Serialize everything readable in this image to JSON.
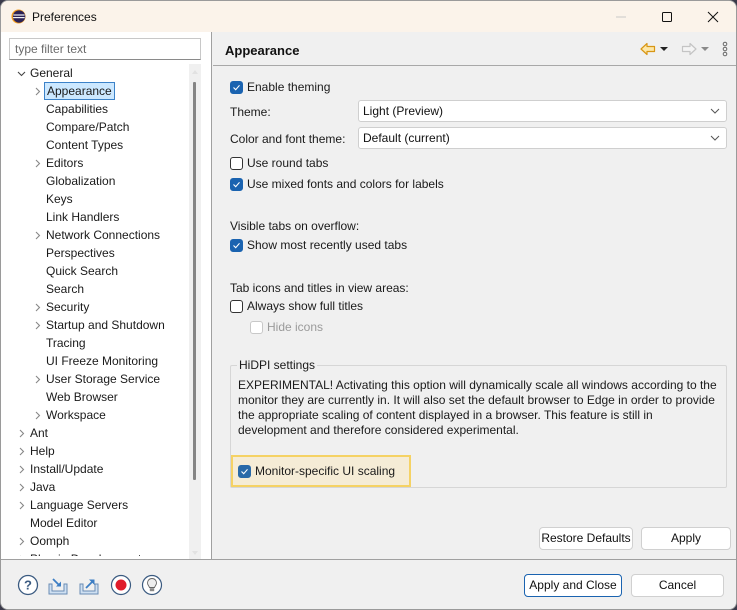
{
  "window": {
    "title": "Preferences",
    "icon": "eclipse-icon",
    "controls": [
      "minimize",
      "maximize",
      "close"
    ]
  },
  "left": {
    "filter_placeholder": "type filter text",
    "filter_value": "",
    "tree": [
      {
        "label": "General",
        "level": 0,
        "expander": "expanded"
      },
      {
        "label": "Appearance",
        "level": 1,
        "expander": "collapsed",
        "selected": true
      },
      {
        "label": "Capabilities",
        "level": 1,
        "expander": "none"
      },
      {
        "label": "Compare/Patch",
        "level": 1,
        "expander": "none"
      },
      {
        "label": "Content Types",
        "level": 1,
        "expander": "none"
      },
      {
        "label": "Editors",
        "level": 1,
        "expander": "collapsed"
      },
      {
        "label": "Globalization",
        "level": 1,
        "expander": "none"
      },
      {
        "label": "Keys",
        "level": 1,
        "expander": "none"
      },
      {
        "label": "Link Handlers",
        "level": 1,
        "expander": "none"
      },
      {
        "label": "Network Connections",
        "level": 1,
        "expander": "collapsed"
      },
      {
        "label": "Perspectives",
        "level": 1,
        "expander": "none"
      },
      {
        "label": "Quick Search",
        "level": 1,
        "expander": "none"
      },
      {
        "label": "Search",
        "level": 1,
        "expander": "none"
      },
      {
        "label": "Security",
        "level": 1,
        "expander": "collapsed"
      },
      {
        "label": "Startup and Shutdown",
        "level": 1,
        "expander": "collapsed"
      },
      {
        "label": "Tracing",
        "level": 1,
        "expander": "none"
      },
      {
        "label": "UI Freeze Monitoring",
        "level": 1,
        "expander": "none"
      },
      {
        "label": "User Storage Service",
        "level": 1,
        "expander": "collapsed"
      },
      {
        "label": "Web Browser",
        "level": 1,
        "expander": "none"
      },
      {
        "label": "Workspace",
        "level": 1,
        "expander": "collapsed"
      },
      {
        "label": "Ant",
        "level": 0,
        "expander": "collapsed"
      },
      {
        "label": "Help",
        "level": 0,
        "expander": "collapsed"
      },
      {
        "label": "Install/Update",
        "level": 0,
        "expander": "collapsed"
      },
      {
        "label": "Java",
        "level": 0,
        "expander": "collapsed"
      },
      {
        "label": "Language Servers",
        "level": 0,
        "expander": "collapsed"
      },
      {
        "label": "Model Editor",
        "level": 0,
        "expander": "none"
      },
      {
        "label": "Oomph",
        "level": 0,
        "expander": "collapsed"
      },
      {
        "label": "Plug-in Development",
        "level": 0,
        "expander": "collapsed"
      }
    ]
  },
  "page": {
    "title": "Appearance",
    "nav": {
      "back": "back-arrow-icon",
      "forward": "forward-arrow-icon",
      "menu": "view-menu-icon"
    },
    "enable_theming": {
      "label": "Enable theming",
      "checked": true
    },
    "theme": {
      "label": "Theme:",
      "value": "Light (Preview)"
    },
    "color_font_theme": {
      "label": "Color and font theme:",
      "value": "Default (current)"
    },
    "round_tabs": {
      "label": "Use round tabs",
      "checked": false
    },
    "mixed_fonts": {
      "label": "Use mixed fonts and colors for labels",
      "checked": true
    },
    "overflow_heading": "Visible tabs on overflow:",
    "mru_tabs": {
      "label": "Show most recently used tabs",
      "checked": true
    },
    "tab_icons_heading": "Tab icons and titles in view areas:",
    "full_titles": {
      "label": "Always show full titles",
      "checked": false
    },
    "hide_icons": {
      "label": "Hide icons",
      "checked": false,
      "enabled": false
    },
    "hidpi": {
      "legend": "HiDPI settings",
      "description": "EXPERIMENTAL! Activating this option will dynamically scale all windows according to the monitor they are currently in. It will also set the default browser to Edge in order to provide the appropriate scaling of content displayed in a browser. This feature is still in development and therefore considered experimental.",
      "monitor_scaling": {
        "label": "Monitor-specific UI scaling",
        "checked": true
      }
    },
    "restore_defaults": "Restore Defaults",
    "apply": "Apply"
  },
  "footer": {
    "icons": [
      "help-icon",
      "import-icon",
      "export-icon",
      "record-icon",
      "tip-icon"
    ],
    "apply_close": "Apply and Close",
    "cancel": "Cancel"
  },
  "colors": {
    "accent": "#1a63b0",
    "selection_bg": "#cce8ff",
    "highlight_border": "#f5d264",
    "titlebar_bg": "#fbf3ea"
  }
}
